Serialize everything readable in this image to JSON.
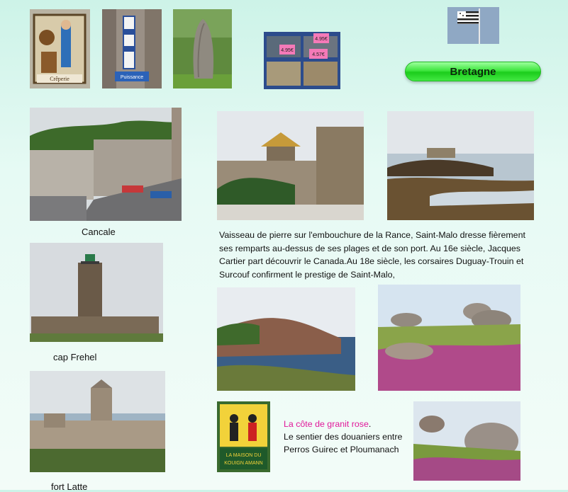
{
  "header": {
    "button_label": "Bretagne"
  },
  "photos": {
    "creperie_sign": {
      "text": "Crêperie",
      "icon": "creperie-sign-photo"
    },
    "lighthouse_sign": {
      "text": "Puissance",
      "icon": "lighthouse-sign-photo"
    },
    "menhir": {
      "icon": "menhir-photo"
    },
    "seafood": {
      "prices": [
        "4.95€",
        "4.95€",
        "4.57€"
      ],
      "icon": "seafood-stall-photo"
    },
    "flag": {
      "icon": "breton-flag-photo"
    },
    "cancale": {
      "caption": "Cancale"
    },
    "cap_frehel": {
      "caption": "cap Frehel"
    },
    "fort_latte": {
      "caption": "fort Latte"
    },
    "kouign_poster": {
      "lines": [
        "LA MAISON DU",
        "KOUIGN AMANN"
      ]
    }
  },
  "saint_malo": {
    "text": "Vaisseau de pierre sur l'embouchure de la Rance, Saint-Malo dresse fièrement ses remparts au-dessus de ses plages et de son port. Au 16e siècle, Jacques Cartier part découvrir le Canada.Au 18e siècle, les corsaires Duguay-Trouin et Surcouf confirment le prestige de Saint-Malo,"
  },
  "granit": {
    "title": "La côte de granit rose",
    "title_suffix": ".",
    "line1": "Le sentier des douaniers entre",
    "line2": "Perros Guirec et Ploumanach"
  },
  "colors": {
    "accent_green": "#2ee02e",
    "pink_text": "#e0199a",
    "background": "#d9f6ee"
  }
}
